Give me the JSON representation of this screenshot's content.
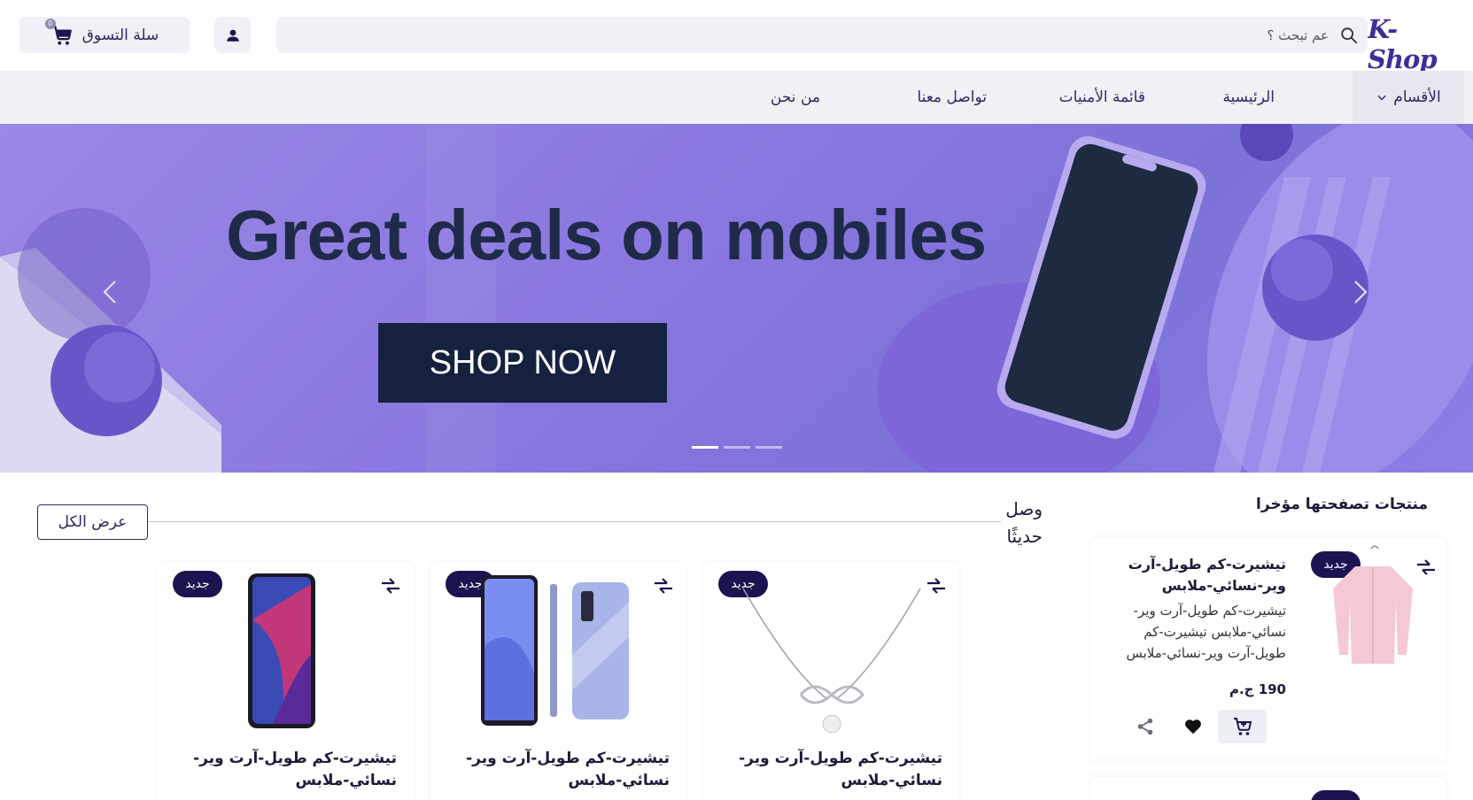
{
  "header": {
    "logo": "K-Shop",
    "search_placeholder": "عم تبحث ؟",
    "cart_label": "سلة التسوق",
    "cart_count": "0"
  },
  "nav": {
    "categories": "الأقسام",
    "home": "الرئيسية",
    "wishlist": "قائمة الأمنيات",
    "contact": "تواصل معنا",
    "about": "من نحن"
  },
  "banner": {
    "title": "Great deals on mobiles",
    "button": "SHOP NOW",
    "slides_total": 3,
    "active_slide": 1
  },
  "new_arrivals": {
    "title": "وصل حديثًا",
    "view_all": "عرض الكل",
    "products": [
      {
        "name": "تيشيرت-كم طويل-آرت وير-نسائي-ملابس",
        "badge": "جديد",
        "image": "necklace"
      },
      {
        "name": "تيشيرت-كم طويل-آرت وير-نسائي-ملابس",
        "badge": "جديد",
        "image": "phone-pair"
      },
      {
        "name": "تيشيرت-كم طويل-آرت وير-نسائي-ملابس",
        "badge": "جديد",
        "image": "phone-single"
      }
    ]
  },
  "recent": {
    "title": "منتجات تصفحتها مؤخرا",
    "item": {
      "name": "تيشيرت-كم طويل-آرت وير-نسائي-ملابس",
      "description": "تيشيرت-كم طويل-آرت وير-نسائي-ملابس تيشيرت-كم طويل-آرت وير-نسائي-ملابس",
      "price": "190 ج.م",
      "badge": "جديد"
    }
  },
  "colors": {
    "brand": "#3a2f9b",
    "badge": "#1a1550",
    "banner": "#8b78e0",
    "button_dark": "#162140"
  }
}
